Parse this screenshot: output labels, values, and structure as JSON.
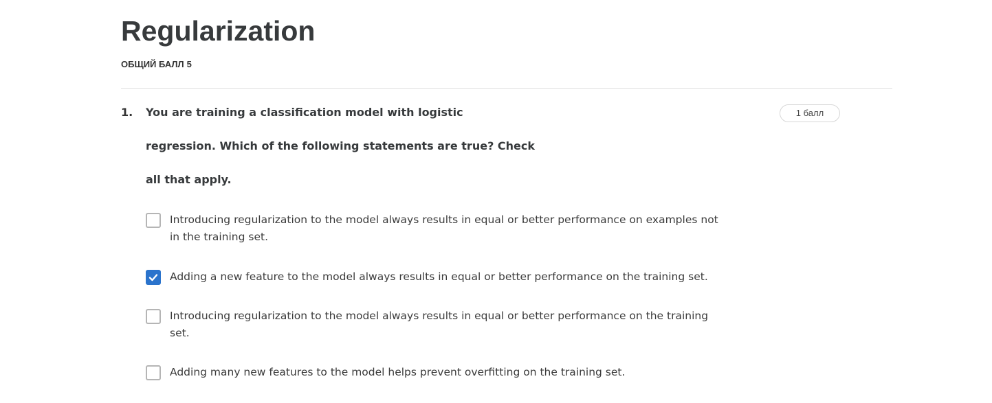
{
  "quiz": {
    "title": "Regularization",
    "total_score_label": "ОБЩИЙ БАЛЛ",
    "total_score_value": "5"
  },
  "question": {
    "number": "1.",
    "points": "1 балл",
    "text_lines": [
      "You are training a classification model with logistic",
      "regression. Which of the following statements are true? Check",
      "all that apply."
    ],
    "options": [
      {
        "label": "Introducing regularization to the model always results in equal or better performance on examples not in the training set.",
        "checked": false
      },
      {
        "label": "Adding a new feature to the model always results in equal or better performance on the training set.",
        "checked": true
      },
      {
        "label": "Introducing regularization to the model always results in equal or better performance on the training set.",
        "checked": false
      },
      {
        "label": "Adding many new features to the model helps prevent overfitting on the training set.",
        "checked": false
      }
    ]
  },
  "colors": {
    "checkbox_checked": "#2a73cc",
    "checkbox_border": "#b5b5b5",
    "divider": "#e1e1e1"
  }
}
